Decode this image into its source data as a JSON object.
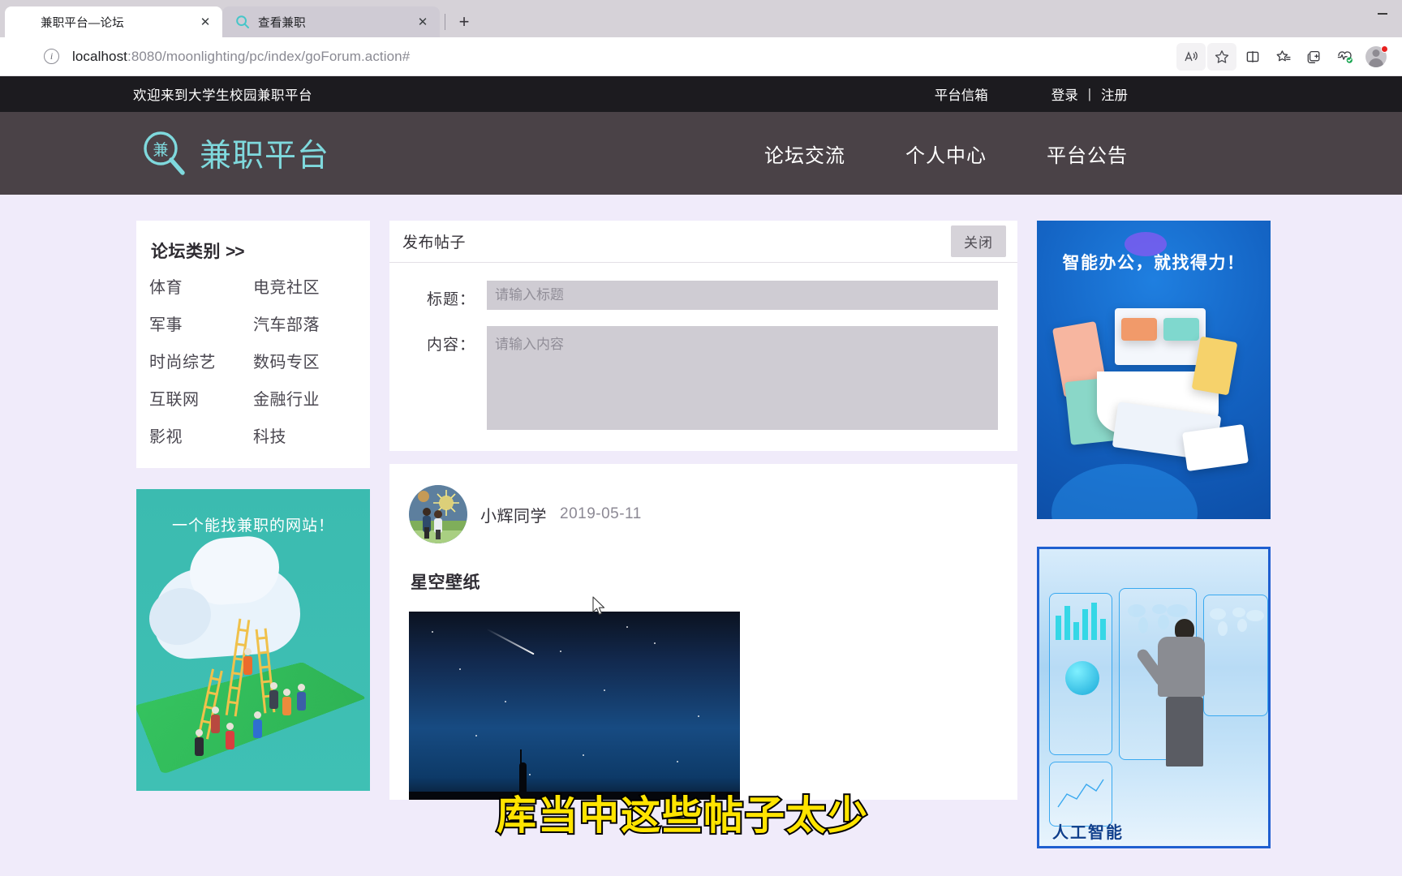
{
  "browser": {
    "tabs": [
      {
        "title": "兼职平台—论坛",
        "favicon": "none-icon",
        "active": true,
        "close_label": "✕"
      },
      {
        "title": "查看兼职",
        "favicon": "magnifier-icon",
        "active": false,
        "close_label": "✕"
      }
    ],
    "new_tab_label": "+",
    "minimize_label": "—",
    "url_host": "localhost",
    "url_path": ":8080/moonlighting/pc/index/goForum.action#",
    "toolbar_icons": [
      "read-aloud-icon",
      "favorite-star-icon",
      "split-screen-icon",
      "collections-star-icon",
      "add-tab-group-icon",
      "browser-essentials-icon"
    ],
    "profile": "avatar-icon"
  },
  "topbar": {
    "welcome": "欢迎来到大学生校园兼职平台",
    "mailbox": "平台信箱",
    "login": "登录",
    "separator": "|",
    "register": "注册"
  },
  "header": {
    "brand_mark": "兼",
    "brand_name": "兼职平台",
    "nav": [
      {
        "label": "论坛交流"
      },
      {
        "label": "个人中心"
      },
      {
        "label": "平台公告"
      }
    ],
    "accent": "#7fd9dd",
    "background": "#4a4247"
  },
  "sidebar": {
    "category_title": "论坛类别",
    "category_chevron": ">>",
    "categories": [
      {
        "label": "体育"
      },
      {
        "label": "电竞社区"
      },
      {
        "label": "军事"
      },
      {
        "label": "汽车部落"
      },
      {
        "label": "时尚综艺"
      },
      {
        "label": "数码专区"
      },
      {
        "label": "互联网"
      },
      {
        "label": "金融行业"
      },
      {
        "label": "影视"
      },
      {
        "label": "科技"
      }
    ],
    "ad": {
      "text": "一个能找兼职的网站！",
      "background": "#3bbbb0"
    }
  },
  "post_form": {
    "heading": "发布帖子",
    "close_label": "关闭",
    "title_label": "标题：",
    "title_value": "",
    "title_placeholder": "请输入标题",
    "content_label": "内容：",
    "content_value": "",
    "content_placeholder": "请输入内容"
  },
  "posts": [
    {
      "author": "小辉同学",
      "date": "2019-05-11",
      "title": "星空壁纸",
      "avatar": "user-avatar"
    }
  ],
  "caption_overlay": {
    "text": "库当中这些帖子太少",
    "color": "#ffe400",
    "stroke": "#000000"
  },
  "right_ads": [
    {
      "title": "智能办公，就找得力！",
      "background": "#1464c4"
    },
    {
      "title": "人工智能",
      "background": "#a9d4f3"
    }
  ],
  "page": {
    "background": "#f0ebfa"
  }
}
